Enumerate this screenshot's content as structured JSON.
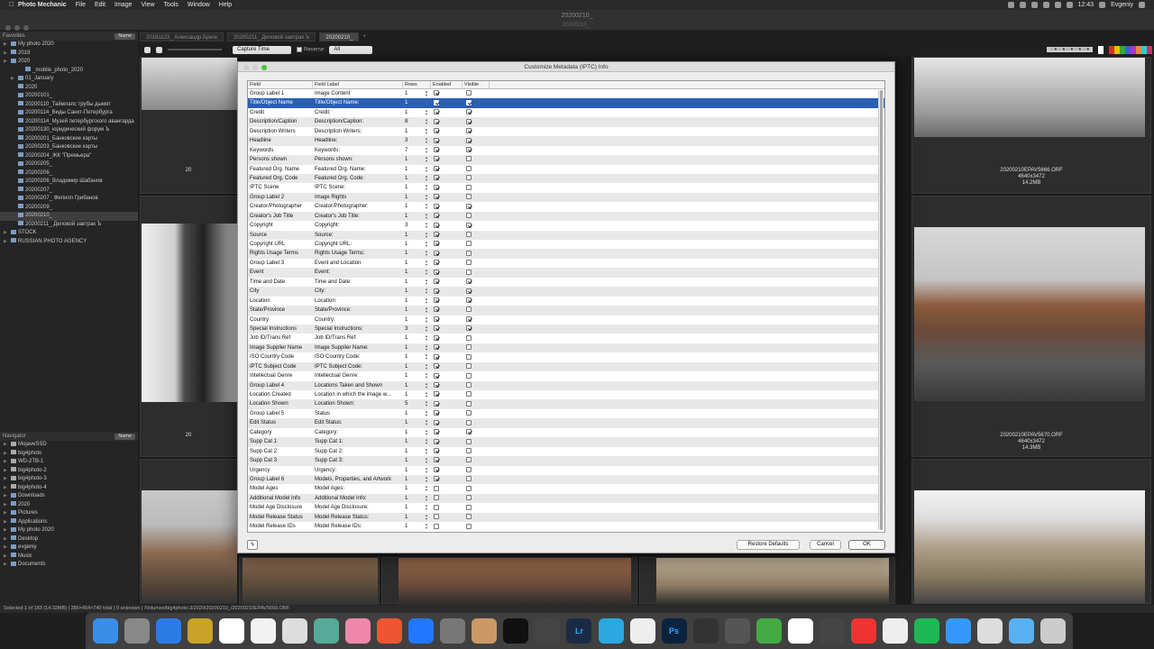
{
  "menubar": {
    "app": "Photo Mechanic",
    "items": [
      "File",
      "Edit",
      "Image",
      "View",
      "Tools",
      "Window",
      "Help"
    ],
    "time": "12:43",
    "user": "Evgeniy"
  },
  "window": {
    "title": "20200210_",
    "subtitle": "20200210_"
  },
  "tabs": [
    {
      "label": "20181123_ Александр Бреге"
    },
    {
      "label": "20200211_ Деловой завтрак Ъ"
    },
    {
      "label": "20200210_"
    }
  ],
  "sidebar": {
    "favorites_label": "Favorites",
    "sort_button": "Name",
    "favorites": [
      "My photo 2020",
      "2019",
      "2020",
      "_mobile_photo_2020",
      "01_January",
      "2020",
      "20200101_",
      "20200110_Таймлапс трубы дымят",
      "20200114_Виды Санкт-Петербурга",
      "20200114_Музей петербургского авангарда",
      "20200130_юридический форум Ъ",
      "20200201_Банковские карты",
      "20200203_Банковские карты",
      "20200204_ЖК \"Премьера\"",
      "20200205_",
      "20200206_",
      "20200206_Владимир Шабанов",
      "20200207_",
      "20200207_ Филипп Грибанов",
      "20200209_",
      "20200210_",
      "20200211_ Деловой завтрак Ъ",
      "STOCK",
      "RUSSIAN PHOTO AGENCY"
    ],
    "navigator_label": "Navigator",
    "navigator": [
      "MojaveSSD",
      "big4photo",
      "WD-2TB-1",
      "big4photo-2",
      "big4photo-3",
      "big4photo-4",
      "Downloads",
      "2020",
      "Pictures",
      "Applications",
      "My photo 2020",
      "Desktop",
      "evgeniy",
      "Music",
      "Documents"
    ]
  },
  "toolbar": {
    "sort_value": "Capture Time",
    "reverse_label": "Reverse",
    "filter_value": "All",
    "rating_stars": "☆★☆★☆★☆★☆★"
  },
  "thumbnails": [
    {
      "filename": "20200210EPAV5666.ORF",
      "dims": "4640x3472",
      "size": "14.2MB"
    },
    {
      "filename": "20200210EPAV5670.ORF",
      "dims": "4640x3472",
      "size": "14.3MB"
    },
    {
      "partial_1": "20",
      "partial_2": "20"
    }
  ],
  "dialog": {
    "title": "Customize Metadata (IPTC) Info",
    "columns": [
      "Field",
      "Field Label",
      "Rows",
      "Enabled",
      "Visible"
    ],
    "rows": [
      {
        "field": "Group Label 1",
        "label": "Image Content",
        "rows": "1",
        "enabled": true,
        "visible": false
      },
      {
        "field": "Title/Object Name",
        "label": "Title/Object Name:",
        "rows": "1",
        "enabled": true,
        "visible": true,
        "selected": true
      },
      {
        "field": "Credit",
        "label": "Credit:",
        "rows": "1",
        "enabled": true,
        "visible": true
      },
      {
        "field": "Description/Caption",
        "label": "Description/Caption:",
        "rows": "8",
        "enabled": true,
        "visible": true
      },
      {
        "field": "Description Writers",
        "label": "Description Writers:",
        "rows": "1",
        "enabled": true,
        "visible": true
      },
      {
        "field": "Headline",
        "label": "Headline:",
        "rows": "3",
        "enabled": true,
        "visible": true
      },
      {
        "field": "Keywords",
        "label": "Keywords:",
        "rows": "7",
        "enabled": true,
        "visible": true
      },
      {
        "field": "Persons shown",
        "label": "Persons shown:",
        "rows": "1",
        "enabled": true,
        "visible": false
      },
      {
        "field": "Featured Org. Name",
        "label": "Featured Org. Name:",
        "rows": "1",
        "enabled": true,
        "visible": false
      },
      {
        "field": "Featured Org. Code",
        "label": "Featured Org. Code:",
        "rows": "1",
        "enabled": true,
        "visible": false
      },
      {
        "field": "IPTC Scene",
        "label": "IPTC Scene:",
        "rows": "1",
        "enabled": true,
        "visible": false
      },
      {
        "field": "Group Label 2",
        "label": "Image Rights",
        "rows": "1",
        "enabled": true,
        "visible": false
      },
      {
        "field": "Creator/Photographer",
        "label": "Creator/Photographer:",
        "rows": "1",
        "enabled": true,
        "visible": true
      },
      {
        "field": "Creator's Job Title",
        "label": "Creator's Job Title:",
        "rows": "1",
        "enabled": true,
        "visible": false
      },
      {
        "field": "Copyright",
        "label": "Copyright:",
        "rows": "3",
        "enabled": true,
        "visible": true
      },
      {
        "field": "Source",
        "label": "Source:",
        "rows": "1",
        "enabled": true,
        "visible": false
      },
      {
        "field": "Copyright URL",
        "label": "Copyright URL:",
        "rows": "1",
        "enabled": true,
        "visible": false
      },
      {
        "field": "Rights Usage Terms",
        "label": "Rights Usage Terms:",
        "rows": "1",
        "enabled": true,
        "visible": false
      },
      {
        "field": "Group Label 3",
        "label": "Event and Location",
        "rows": "1",
        "enabled": true,
        "visible": false
      },
      {
        "field": "Event",
        "label": "Event:",
        "rows": "1",
        "enabled": true,
        "visible": false
      },
      {
        "field": "Time and Date",
        "label": "Time and Date:",
        "rows": "1",
        "enabled": true,
        "visible": true
      },
      {
        "field": "City",
        "label": "City:",
        "rows": "1",
        "enabled": true,
        "visible": true
      },
      {
        "field": "Location",
        "label": "Location:",
        "rows": "1",
        "enabled": true,
        "visible": true
      },
      {
        "field": "State/Province",
        "label": "State/Province:",
        "rows": "1",
        "enabled": true,
        "visible": false
      },
      {
        "field": "Country",
        "label": "Country:",
        "rows": "1",
        "enabled": true,
        "visible": true
      },
      {
        "field": "Special Instructions",
        "label": "Special Instructions:",
        "rows": "3",
        "enabled": true,
        "visible": true
      },
      {
        "field": "Job ID/Trans Ref",
        "label": "Job ID/Trans Ref:",
        "rows": "1",
        "enabled": true,
        "visible": false
      },
      {
        "field": "Image Supplier Name",
        "label": "Image Supplier Name:",
        "rows": "1",
        "enabled": true,
        "visible": false
      },
      {
        "field": "ISO Country Code",
        "label": "ISO Country Code:",
        "rows": "1",
        "enabled": true,
        "visible": false
      },
      {
        "field": "IPTC Subject Code",
        "label": "IPTC Subject Code:",
        "rows": "1",
        "enabled": true,
        "visible": false
      },
      {
        "field": "Intellectual Genre",
        "label": "Intellectual Genre:",
        "rows": "1",
        "enabled": true,
        "visible": false
      },
      {
        "field": "Group Label 4",
        "label": "Locations Taken and Shown",
        "rows": "1",
        "enabled": true,
        "visible": false
      },
      {
        "field": "Location Created",
        "label": "Location in which the image w...",
        "rows": "1",
        "enabled": true,
        "visible": false
      },
      {
        "field": "Location Shown",
        "label": "Location Shown:",
        "rows": "5",
        "enabled": true,
        "visible": false
      },
      {
        "field": "Group Label 5",
        "label": "Status",
        "rows": "1",
        "enabled": true,
        "visible": false
      },
      {
        "field": "Edit Status",
        "label": "Edit Status:",
        "rows": "1",
        "enabled": true,
        "visible": false
      },
      {
        "field": "Category",
        "label": "Category:",
        "rows": "1",
        "enabled": true,
        "visible": true
      },
      {
        "field": "Supp Cat 1",
        "label": "Supp Cat 1:",
        "rows": "1",
        "enabled": true,
        "visible": false
      },
      {
        "field": "Supp Cat 2",
        "label": "Supp Cat 2:",
        "rows": "1",
        "enabled": true,
        "visible": false
      },
      {
        "field": "Supp Cat 3",
        "label": "Supp Cat 3:",
        "rows": "1",
        "enabled": true,
        "visible": false
      },
      {
        "field": "Urgency",
        "label": "Urgency:",
        "rows": "1",
        "enabled": true,
        "visible": false
      },
      {
        "field": "Group Label 6",
        "label": "Models, Properties, and Artwork",
        "rows": "1",
        "enabled": true,
        "visible": false
      },
      {
        "field": "Model Ages",
        "label": "Model Ages:",
        "rows": "1",
        "enabled": false,
        "visible": false
      },
      {
        "field": "Additional Model Info",
        "label": "Additional Model Info:",
        "rows": "1",
        "enabled": false,
        "visible": false
      },
      {
        "field": "Model Age Disclosure",
        "label": "Model Age Disclosure:",
        "rows": "1",
        "enabled": false,
        "visible": false
      },
      {
        "field": "Model Release Status",
        "label": "Model Release Status:",
        "rows": "1",
        "enabled": false,
        "visible": false
      },
      {
        "field": "Model Release IDs",
        "label": "Model Release IDs:",
        "rows": "1",
        "enabled": false,
        "visible": false
      }
    ],
    "restore_label": "Restore Defaults",
    "cancel_label": "Cancel",
    "ok_label": "OK",
    "lightning": "ϟ"
  },
  "status": "Selected 1 of 183 (14.32MB) | 286×454×740 total | 0 unknown | /Volumes/big4photo-3/2020/20200210_/20200210EPAV5669.ORF",
  "dock": [
    "Finder",
    "Launchpad",
    "Safari",
    "Notes",
    "Calendar",
    "Stickies",
    "Reminders",
    "Maps",
    "Photos",
    "iTunes",
    "App Store",
    "System Preferences",
    "Archive",
    "Terminal",
    "Photo Mechanic",
    "Lightroom",
    "Telegram",
    "Script",
    "Photoshop",
    "Camera",
    "Capture",
    "Globe",
    "TextEdit",
    "Settings",
    "Vivaldi",
    "Chrome",
    "Spotify",
    "Navigator",
    "Preview",
    "Folder",
    "Trash"
  ]
}
